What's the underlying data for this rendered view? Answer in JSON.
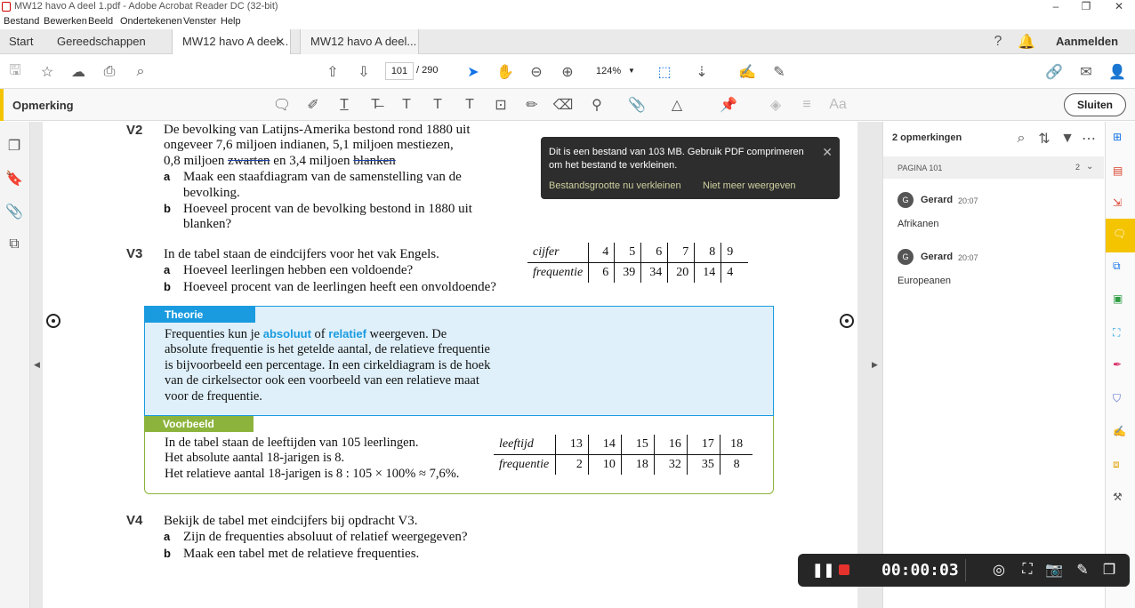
{
  "window": {
    "title": "MW12 havo A deel 1.pdf - Adobe Acrobat Reader DC (32-bit)"
  },
  "menu": [
    "Bestand",
    "Bewerken",
    "Beeld",
    "Ondertekenen",
    "Venster",
    "Help"
  ],
  "tabs": {
    "home": "Start",
    "tools": "Gereedschappen",
    "doc1": "MW12 havo A deel...",
    "doc2": "MW12 havo A deel...",
    "signin": "Aanmelden"
  },
  "toolbar": {
    "page_current": "101",
    "page_total": "/ 290",
    "zoom": "124%"
  },
  "comment_bar": {
    "label": "Opmerking",
    "close": "Sluiten"
  },
  "tooltip": {
    "message": "Dit is een bestand van 103 MB. Gebruik PDF comprimeren om het bestand te verkleinen.",
    "link1": "Bestandsgrootte nu verkleinen",
    "link2": "Niet meer weergeven"
  },
  "document": {
    "v2": {
      "num": "V2",
      "line1": "De bevolking van Latijns-Amerika bestond rond 1880 uit",
      "line2": "ongeveer 7,6 miljoen indianen, 5,1 miljoen mestiezen,",
      "line3_pre": "0,8 miljoen ",
      "line3_s1": "zwarten",
      "line3_mid": " en 3,4 miljoen ",
      "line3_s2": "blanken",
      "a": "Maak een staafdiagram van de samenstelling van de",
      "a2": "bevolking.",
      "b": "Hoeveel procent van de bevolking bestond in 1880 uit",
      "b2": "blanken?"
    },
    "v3": {
      "num": "V3",
      "line1": "In de tabel staan de eindcijfers voor het vak Engels.",
      "a": "Hoeveel leerlingen hebben een voldoende?",
      "b": "Hoeveel procent van de leerlingen heeft een onvoldoende?",
      "table": {
        "row1_label": "cijfer",
        "row1": [
          "4",
          "5",
          "6",
          "7",
          "8",
          "9"
        ],
        "row2_label": "frequentie",
        "row2": [
          "6",
          "39",
          "34",
          "20",
          "14",
          "4"
        ]
      }
    },
    "theorie": {
      "header": "Theorie",
      "t1": "Frequenties kun je ",
      "kw1": "absoluut",
      "t2": " of ",
      "kw2": "relatief",
      "t3": " weergeven. De",
      "l2": "absolute frequentie is het getelde aantal, de relatieve frequentie",
      "l3": "is bijvoorbeeld een percentage. In een cirkeldiagram is de hoek",
      "l4": "van de cirkelsector ook een voorbeeld van een relatieve maat",
      "l5": "voor de frequentie."
    },
    "voorbeeld": {
      "header": "Voorbeeld",
      "l1": "In de tabel staan de leeftijden van 105 leerlingen.",
      "l2": "Het absolute aantal 18-jarigen is 8.",
      "l3": "Het relatieve aantal 18-jarigen is 8 : 105 × 100% ≈ 7,6%.",
      "table": {
        "row1_label": "leeftijd",
        "row1": [
          "13",
          "14",
          "15",
          "16",
          "17",
          "18"
        ],
        "row2_label": "frequentie",
        "row2": [
          "2",
          "10",
          "18",
          "32",
          "35",
          "8"
        ]
      }
    },
    "v4": {
      "num": "V4",
      "line1": "Bekijk de tabel met eindcijfers bij opdracht V3.",
      "a": "Zijn de frequenties absoluut of relatief weergegeven?",
      "b": "Maak een tabel met de relatieve frequenties."
    }
  },
  "comments_panel": {
    "title": "2 opmerkingen",
    "page_label": "PAGINA 101",
    "page_count": "2",
    "comments": [
      {
        "avatar": "G",
        "author": "Gerard",
        "time": "20:07",
        "text": "Afrikanen"
      },
      {
        "avatar": "G",
        "author": "Gerard",
        "time": "20:07",
        "text": "Europeanen"
      }
    ]
  },
  "recorder": {
    "timer": "00:00:03"
  }
}
